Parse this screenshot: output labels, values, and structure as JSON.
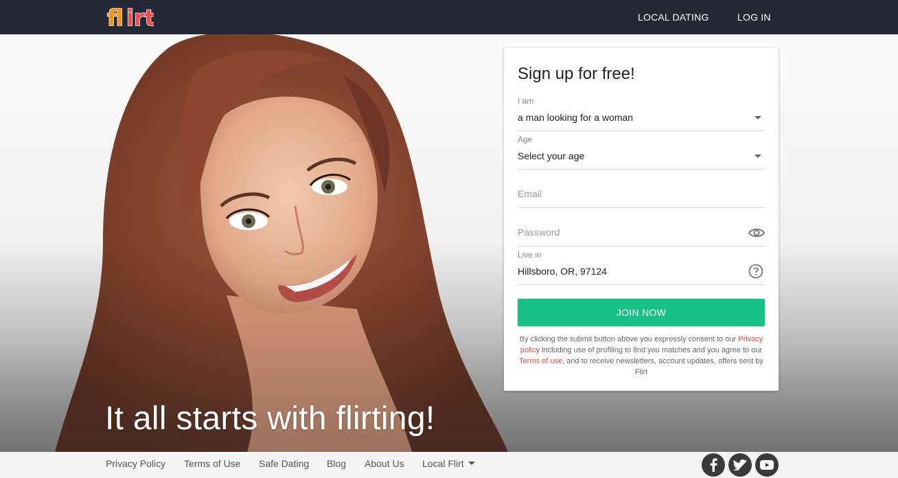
{
  "header": {
    "logo_text": "flirt",
    "nav": {
      "local_dating": "LOCAL DATING",
      "log_in": "LOG IN"
    }
  },
  "hero": {
    "tagline": "It all starts with flirting!"
  },
  "signup": {
    "title": "Sign up for free!",
    "i_am": {
      "label": "I am",
      "value": "a man looking for a woman"
    },
    "age": {
      "label": "Age",
      "value": "Select your age"
    },
    "email": {
      "placeholder": "Email"
    },
    "password": {
      "placeholder": "Password"
    },
    "live_in": {
      "label": "Live in",
      "value": "Hillsboro, OR, 97124"
    },
    "join_label": "JOIN NOW",
    "consent": {
      "part1": "By clicking the submit button above you expressly consent to our",
      "privacy_link": "Privacy policy",
      "part2": "including use of profiling to find you matches and you agree to our",
      "terms_link": "Terms of use",
      "part3": ", and to receive newsletters, account updates, offers sent by Flirt"
    }
  },
  "footer": {
    "links": {
      "privacy": "Privacy Policy",
      "terms": "Terms of Use",
      "safe": "Safe Dating",
      "blog": "Blog",
      "about": "About Us",
      "local": "Local Flirt"
    },
    "social": [
      "facebook-icon",
      "twitter-icon",
      "youtube-icon"
    ]
  },
  "colors": {
    "topbar": "#232a35",
    "join_button": "#16c086",
    "link_red": "#e0473c",
    "logo_orange": "#f7941d"
  }
}
